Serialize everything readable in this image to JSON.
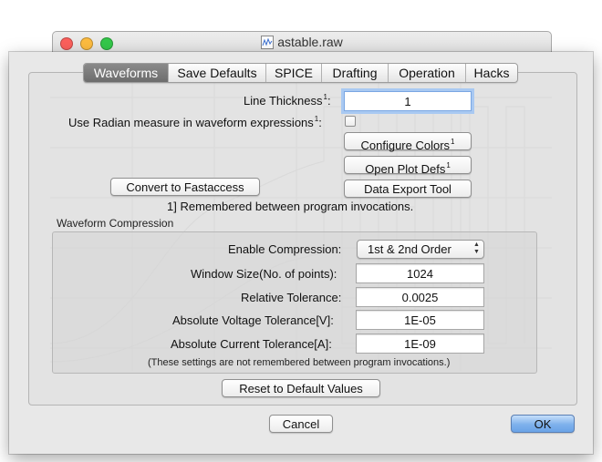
{
  "window": {
    "title": "astable.raw",
    "traffic_lights": [
      "#fc605c",
      "#fdbc40",
      "#34c84a"
    ]
  },
  "tabs": [
    {
      "label": "Waveforms",
      "selected": true
    },
    {
      "label": "Save Defaults",
      "selected": false
    },
    {
      "label": "SPICE",
      "selected": false
    },
    {
      "label": "Drafting",
      "selected": false
    },
    {
      "label": "Operation",
      "selected": false
    },
    {
      "label": "Hacks",
      "selected": false
    }
  ],
  "waveforms": {
    "line_thickness_label": "Line Thickness",
    "line_thickness_value": "1",
    "superscript": "1",
    "radian_label": "Use Radian measure in waveform expressions",
    "radian_checked": false,
    "configure_colors": "Configure Colors",
    "open_plot_defs": "Open Plot Defs",
    "convert_fastaccess": "Convert to Fastaccess",
    "data_export": "Data Export Tool",
    "footnote": "1] Remembered between program invocations."
  },
  "compression": {
    "group_title": "Waveform Compression",
    "enable_label": "Enable Compression:",
    "enable_value": "1st & 2nd Order",
    "window_size_label": "Window Size(No. of points):",
    "window_size_value": "1024",
    "relative_tol_label": "Relative Tolerance:",
    "relative_tol_value": "0.0025",
    "abs_voltage_label": "Absolute Voltage Tolerance[V]:",
    "abs_voltage_value": "1E-05",
    "abs_current_label": "Absolute Current Tolerance[A]:",
    "abs_current_value": "1E-09",
    "note": "(These settings are not remembered between program invocations.)"
  },
  "buttons": {
    "reset": "Reset to Default Values",
    "cancel": "Cancel",
    "ok": "OK"
  },
  "colors": {
    "accent": "#6aa3e7",
    "selected_tab": "#7a7a7a"
  }
}
